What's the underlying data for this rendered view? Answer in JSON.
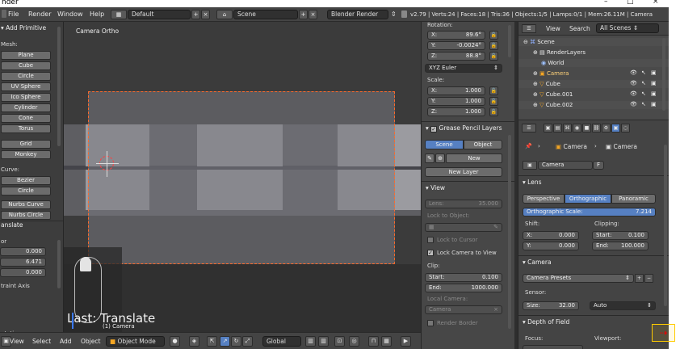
{
  "window": {
    "title": "nder",
    "controls": [
      "–",
      "□",
      "×"
    ]
  },
  "info_header": {
    "menus": [
      "File",
      "Render",
      "Window",
      "Help"
    ],
    "layout": "Default",
    "scene": "Scene",
    "engine": "Blender Render",
    "stats": "v2.79 | Verts:24 | Faces:18 | Tris:36 | Objects:1/5 | Lamps:0/1 | Mem:26.11M | Camera"
  },
  "toolshelf": {
    "header": "Add Primitive",
    "mesh_label": "Mesh:",
    "mesh_buttons": [
      "Plane",
      "Cube",
      "Circle",
      "UV Sphere",
      "Ico Sphere",
      "Cylinder",
      "Cone",
      "Torus",
      "Grid",
      "Monkey"
    ],
    "curve_label": "Curve:",
    "curve_buttons": [
      "Bezier",
      "Circle",
      "Nurbs Curve",
      "Nurbs Circle"
    ],
    "operator_title": "anslate",
    "vector_label": "or",
    "vector_values": [
      "0.000",
      "6.471",
      "0.000"
    ],
    "constraint_label": "traint Axis",
    "orientation_label": "ntation"
  },
  "viewport": {
    "label": "Camera Ortho",
    "last_operator": "Last: Translate",
    "object_label": "(1) Camera"
  },
  "viewport_header": {
    "menus": [
      "View",
      "Select",
      "Add",
      "Object"
    ],
    "mode": "Object Mode",
    "orientation": "Global"
  },
  "npanel": {
    "rotation_label": "Rotation:",
    "rotation": [
      {
        "axis": "X:",
        "value": "89.6°"
      },
      {
        "axis": "Y:",
        "value": "-0.0024°"
      },
      {
        "axis": "Z:",
        "value": "88.8°"
      }
    ],
    "rotation_mode": "XYZ Euler",
    "scale_label": "Scale:",
    "scale": [
      {
        "axis": "X:",
        "value": "1.000"
      },
      {
        "axis": "Y:",
        "value": "1.000"
      },
      {
        "axis": "Z:",
        "value": "1.000"
      }
    ],
    "grease_pencil_header": "Grease Pencil Layers",
    "gp_tabs": [
      "Scene",
      "Object"
    ],
    "gp_new": "New",
    "gp_new_layer": "New Layer",
    "view_header": "View",
    "lens": {
      "label": "Lens:",
      "value": "35.000"
    },
    "lock_to_object": "Lock to Object:",
    "lock_to_cursor": "Lock to Cursor",
    "lock_camera_to_view": "Lock Camera to View",
    "clip_label": "Clip:",
    "clip_start": {
      "label": "Start:",
      "value": "0.100"
    },
    "clip_end": {
      "label": "End:",
      "value": "1000.000"
    },
    "local_camera_label": "Local Camera:",
    "local_camera_value": "Camera",
    "render_border": "Render Border"
  },
  "outliner": {
    "view_menu": "View",
    "search_menu": "Search",
    "filter": "All Scenes",
    "rows": [
      "Scene",
      "RenderLayers",
      "World",
      "Camera",
      "Cube",
      "Cube.001",
      "Cube.002"
    ]
  },
  "properties": {
    "breadcrumb": [
      "Camera",
      "Camera"
    ],
    "datablock": "Camera",
    "datablock_users": "F",
    "lens_header": "Lens",
    "projection_tabs": [
      "Perspective",
      "Orthographic",
      "Panoramic"
    ],
    "ortho_scale": {
      "label": "Orthographic Scale:",
      "value": "7.214"
    },
    "shift_label": "Shift:",
    "shift": [
      {
        "axis": "X:",
        "value": "0.000"
      },
      {
        "axis": "Y:",
        "value": "0.000"
      }
    ],
    "clipping_label": "Clipping:",
    "clipping": [
      {
        "axis": "Start:",
        "value": "0.100"
      },
      {
        "axis": "End:",
        "value": "100.000"
      }
    ],
    "camera_header": "Camera",
    "camera_presets": "Camera Presets",
    "sensor_label": "Sensor:",
    "sensor_size": {
      "label": "Size:",
      "value": "32.00"
    },
    "sensor_fit": "Auto",
    "dof_header": "Depth of Field",
    "focus_label": "Focus:",
    "viewport_label": "Viewport:"
  },
  "colors": {
    "selection_blue": "#5680c2",
    "camera_frame": "#ff6a2a",
    "panel_bg": "#474747"
  }
}
